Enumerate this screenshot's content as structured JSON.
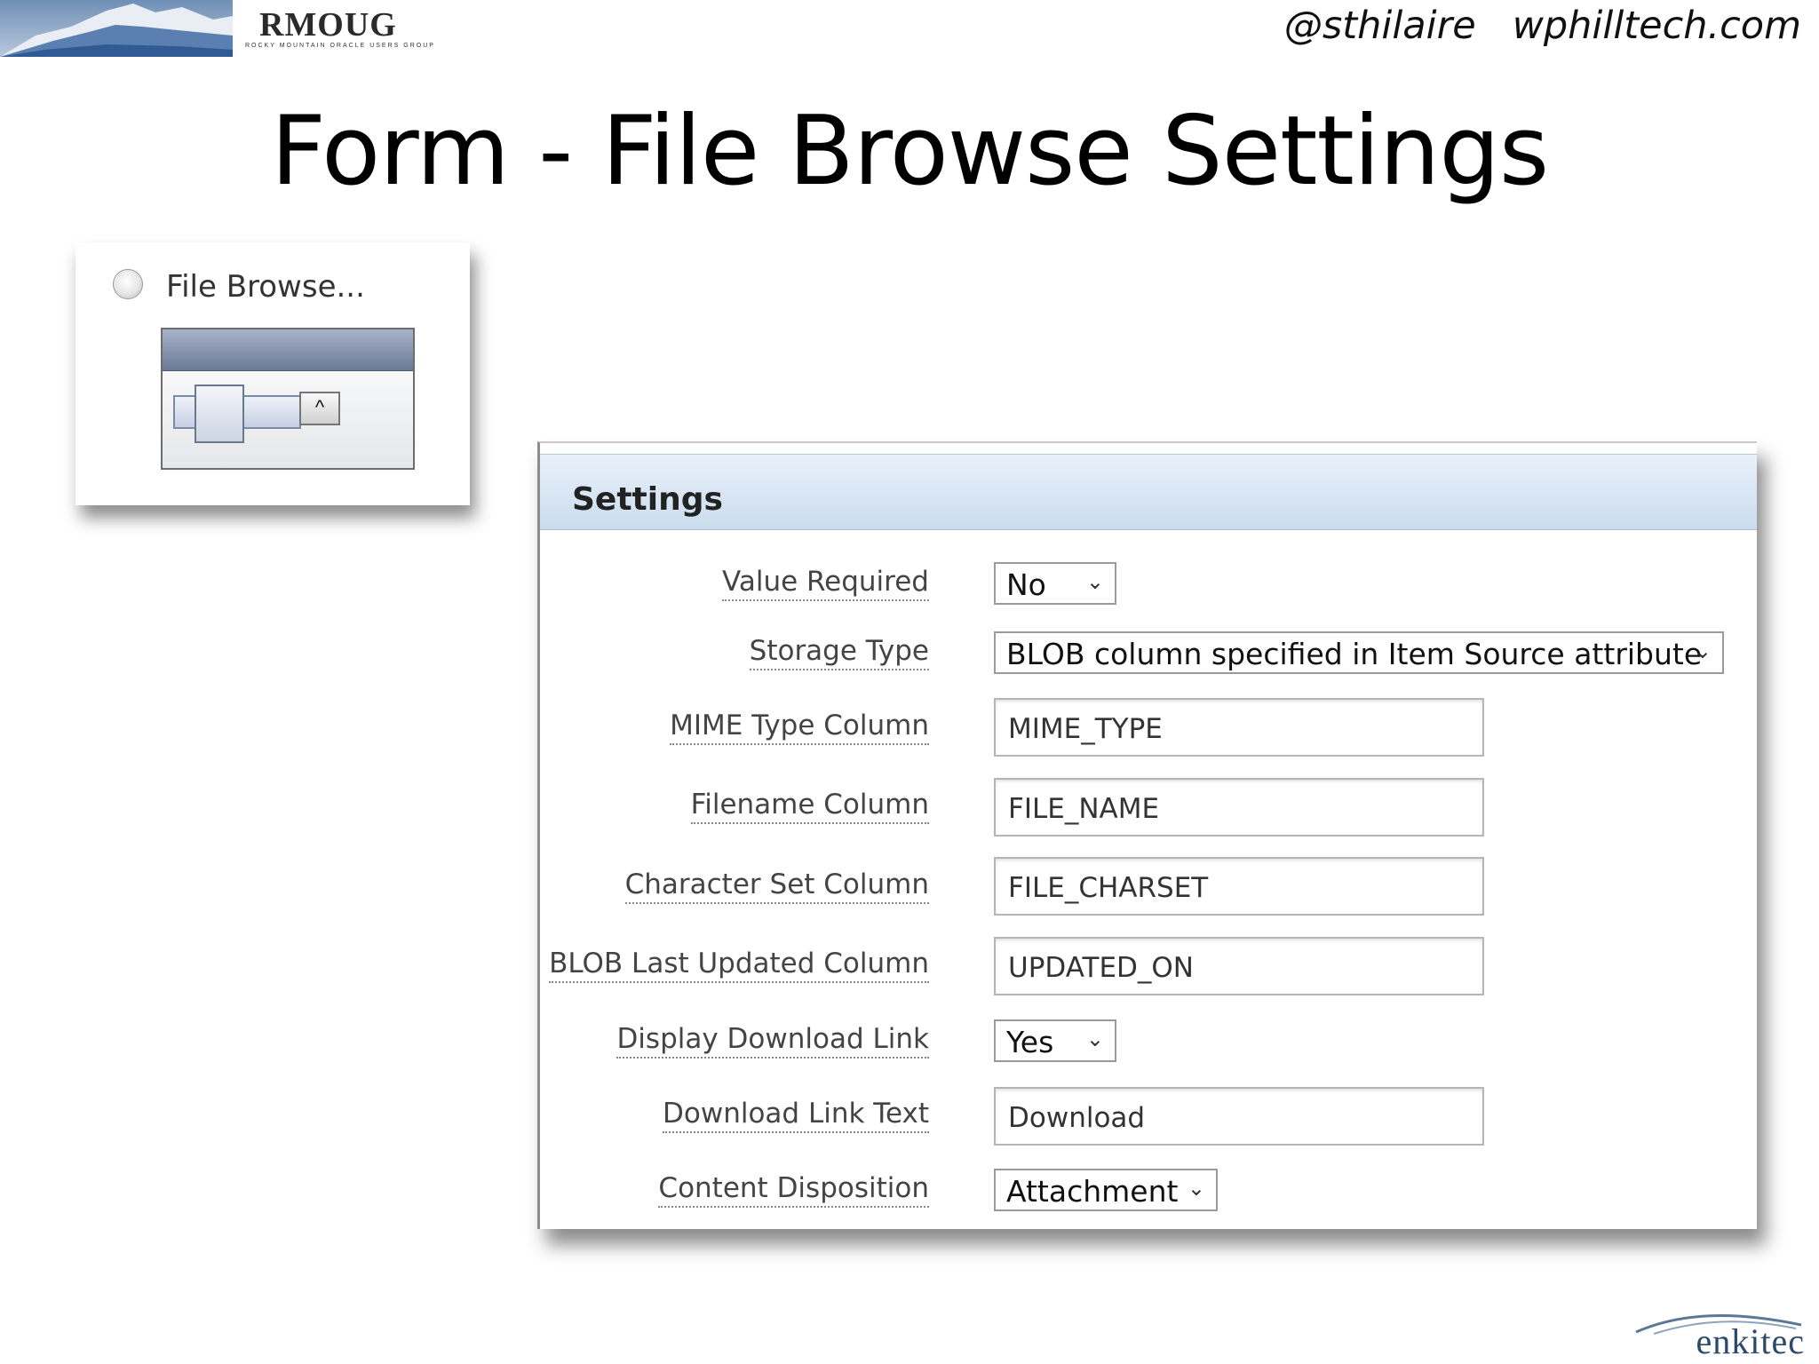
{
  "header": {
    "logo_text": "RMOUG",
    "logo_subtext": "ROCKY MOUNTAIN ORACLE USERS GROUP",
    "handle": "@sthilaire   wphilltech.com"
  },
  "slide": {
    "title": "Form - File Browse Settings"
  },
  "item_type": {
    "label": "File Browse..."
  },
  "settings": {
    "title": "Settings",
    "value_required": {
      "label": "Value Required",
      "value": "No"
    },
    "storage_type": {
      "label": "Storage Type",
      "value": "BLOB column specified in Item Source attribute"
    },
    "mime_type_column": {
      "label": "MIME Type Column",
      "value": "MIME_TYPE"
    },
    "filename_column": {
      "label": "Filename Column",
      "value": "FILE_NAME"
    },
    "character_set_column": {
      "label": "Character Set Column",
      "value": "FILE_CHARSET"
    },
    "blob_last_updated_column": {
      "label": "BLOB Last Updated Column",
      "value": "UPDATED_ON"
    },
    "display_download_link": {
      "label": "Display Download Link",
      "value": "Yes"
    },
    "download_link_text": {
      "label": "Download Link Text",
      "value": "Download"
    },
    "content_disposition": {
      "label": "Content Disposition",
      "value": "Attachment"
    }
  },
  "footer": {
    "logo_text": "enkitec"
  },
  "icons": {
    "dropdown": "chevron-down-icon",
    "upload": "chevron-up-icon"
  }
}
